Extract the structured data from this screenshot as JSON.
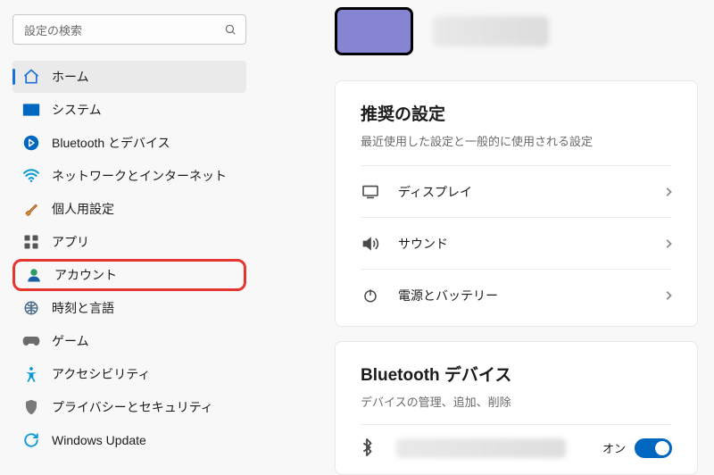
{
  "search": {
    "placeholder": "設定の検索"
  },
  "sidebar": {
    "items": [
      {
        "label": "ホーム"
      },
      {
        "label": "システム"
      },
      {
        "label": "Bluetooth とデバイス"
      },
      {
        "label": "ネットワークとインターネット"
      },
      {
        "label": "個人用設定"
      },
      {
        "label": "アプリ"
      },
      {
        "label": "アカウント"
      },
      {
        "label": "時刻と言語"
      },
      {
        "label": "ゲーム"
      },
      {
        "label": "アクセシビリティ"
      },
      {
        "label": "プライバシーとセキュリティ"
      },
      {
        "label": "Windows Update"
      }
    ]
  },
  "main": {
    "recommended": {
      "title": "推奨の設定",
      "subtitle": "最近使用した設定と一般的に使用される設定",
      "rows": [
        {
          "label": "ディスプレイ"
        },
        {
          "label": "サウンド"
        },
        {
          "label": "電源とバッテリー"
        }
      ]
    },
    "bluetooth": {
      "title": "Bluetooth デバイス",
      "subtitle": "デバイスの管理、追加、削除",
      "toggle": {
        "label": "オン",
        "on": true
      }
    }
  }
}
